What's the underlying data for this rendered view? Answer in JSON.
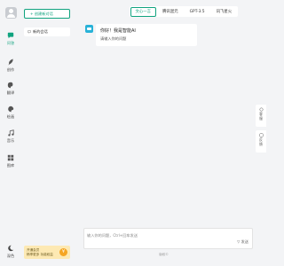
{
  "rail": {
    "items": [
      {
        "label": "问答",
        "icon": "chat-icon",
        "active": true
      },
      {
        "label": "创作",
        "icon": "feather-icon",
        "active": false
      },
      {
        "label": "翻译",
        "icon": "translate-icon",
        "active": false
      },
      {
        "label": "绘画",
        "icon": "palette-icon",
        "active": false
      },
      {
        "label": "音乐",
        "icon": "music-icon",
        "active": false
      },
      {
        "label": "图库",
        "icon": "gallery-icon",
        "active": false
      }
    ],
    "theme_label": "深色"
  },
  "sessions": {
    "new_chat": "+ 创建新对话",
    "items": [
      {
        "title": "新的会话"
      }
    ],
    "promo": {
      "line1": "开通会员",
      "line2": "畅享更多 功能权益",
      "coin": "¥"
    }
  },
  "tabs": [
    {
      "label": "文心一言",
      "active": true
    },
    {
      "label": "腾讯混元",
      "active": false
    },
    {
      "label": "GPT-3.5",
      "active": false
    },
    {
      "label": "讯飞星火",
      "active": false
    }
  ],
  "chat": {
    "greeting": "你好！我是智能AI",
    "sub": "请输入你的问题"
  },
  "input": {
    "placeholder": "输入你的问题，Ctrl+回车发送",
    "send_label": "▽ 发送"
  },
  "footer": "版权©",
  "right_tools": [
    {
      "label": "客服",
      "icon": "service-icon"
    },
    {
      "label": "反馈",
      "icon": "feedback-icon"
    }
  ],
  "colors": {
    "accent": "#10a37f",
    "bot": "#28b2d8",
    "promo_bg": "#fde9b3"
  }
}
